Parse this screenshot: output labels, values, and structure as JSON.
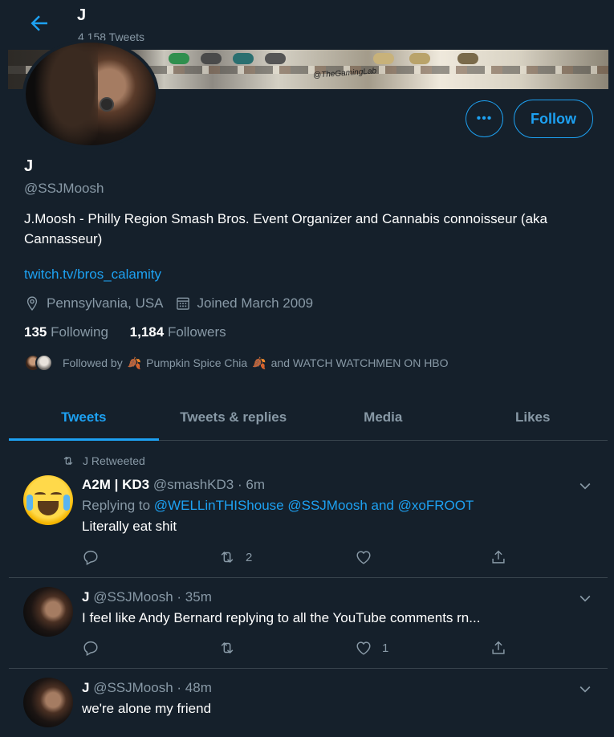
{
  "header": {
    "name": "J",
    "tweet_count": "4,158 Tweets"
  },
  "banner": {
    "text": "@TheGamingLab"
  },
  "profile": {
    "more_button": "•••",
    "follow_label": "Follow",
    "name": "J",
    "handle": "@SSJMoosh",
    "bio": "J.Moosh - Philly Region Smash Bros. Event Organizer and Cannabis connoisseur (aka Cannasseur)",
    "link": "twitch.tv/bros_calamity",
    "location": "Pennsylvania, USA",
    "joined": "Joined March 2009",
    "following_count": "135",
    "following_label": "Following",
    "followers_count": "1,184",
    "followers_label": "Followers",
    "followed_by_prefix": "Followed by",
    "followed_by_name1": "Pumpkin Spice Chia",
    "followed_by_and": "and WATCH WATCHMEN ON HBO"
  },
  "tabs": [
    "Tweets",
    "Tweets & replies",
    "Media",
    "Likes"
  ],
  "tweets": [
    {
      "retweet_label": "J Retweeted",
      "name": "A2M | KD3",
      "handle": "@smashKD3",
      "time": "· 6m",
      "reply_prefix": "Replying to",
      "reply_to": "@WELLinTHIShouse @SSJMoosh and @xoFROOT",
      "text": "Literally eat shit",
      "retweets": "2",
      "likes": ""
    },
    {
      "name": "J",
      "handle": "@SSJMoosh",
      "time": "· 35m",
      "text": "I feel like Andy Bernard replying to all the YouTube comments rn...",
      "retweets": "",
      "likes": "1"
    },
    {
      "name": "J",
      "handle": "@SSJMoosh",
      "time": "· 48m",
      "text": "we're alone my friend"
    }
  ],
  "colors": {
    "background": "#15202b",
    "accent": "#1da1f2",
    "muted": "#8899a6",
    "divider": "#38444d"
  },
  "icons": [
    "back-arrow-icon",
    "location-icon",
    "calendar-icon",
    "retweet-icon",
    "reply-icon",
    "like-icon",
    "share-icon",
    "chevron-down-icon"
  ]
}
